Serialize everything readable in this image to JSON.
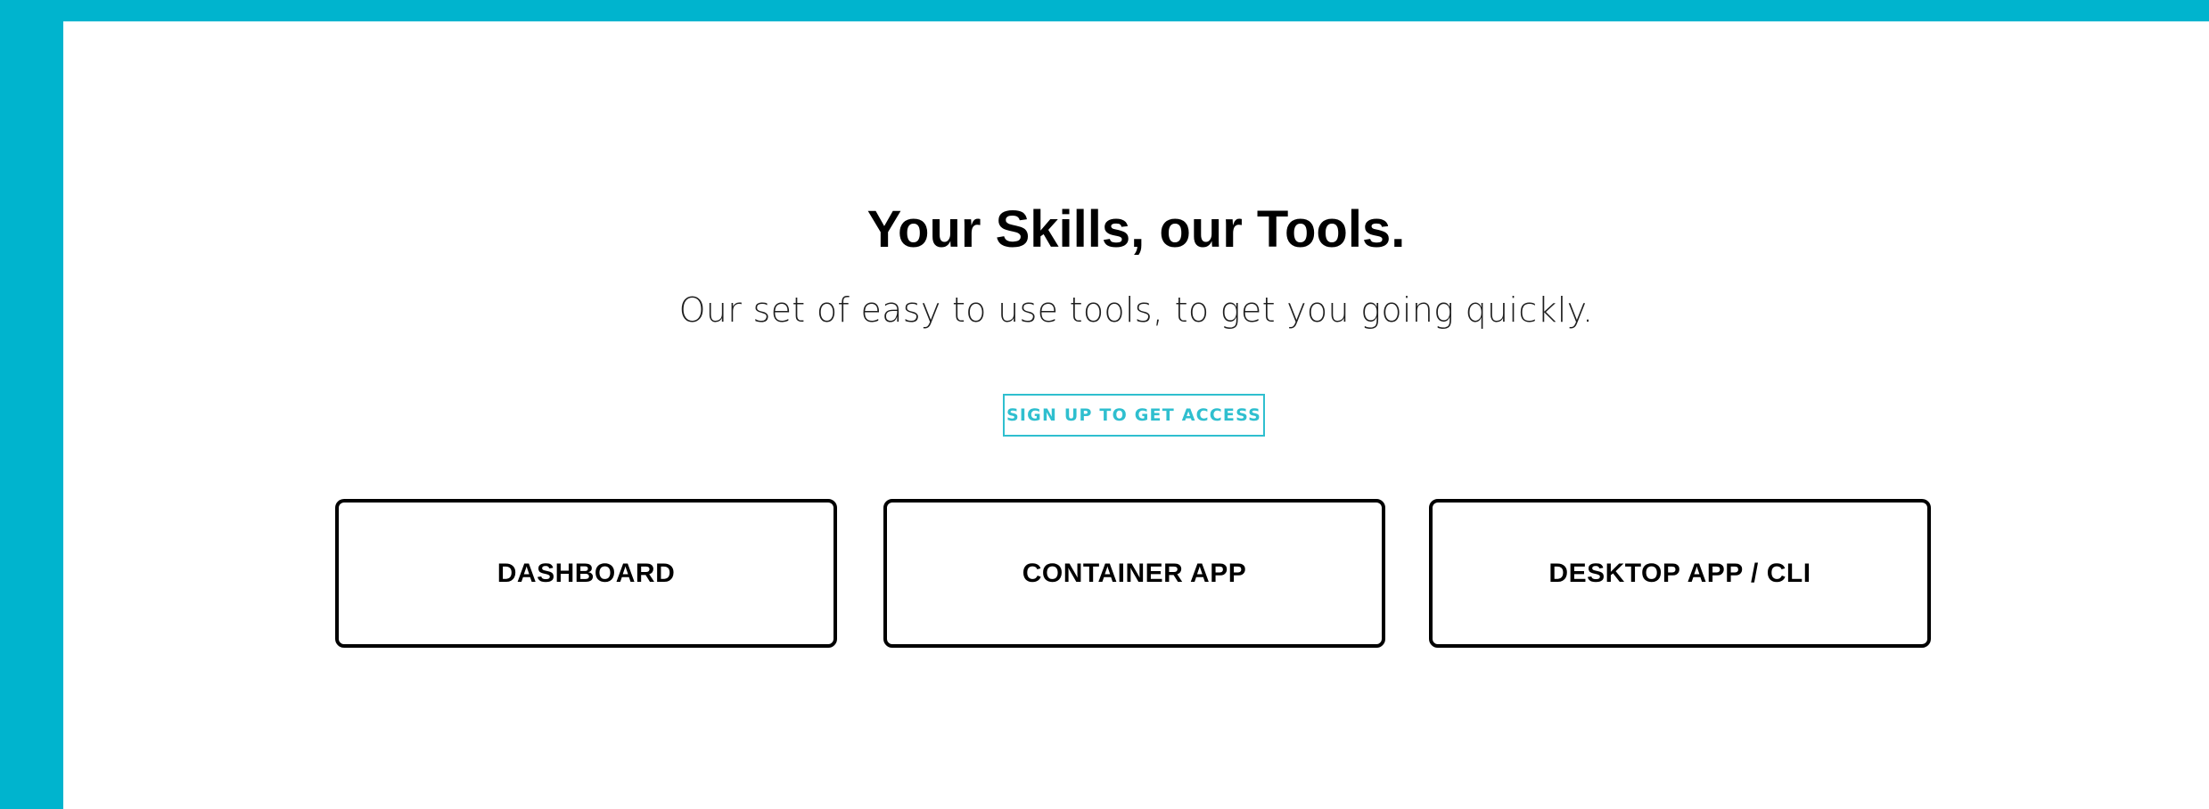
{
  "colors": {
    "frame_background": "#00b4ce",
    "panel_background": "#ffffff",
    "accent": "#2fbfcf",
    "text_primary": "#000000"
  },
  "hero": {
    "title": "Your Skills, our Tools.",
    "subtitle": "Our set of easy to use tools, to get you going quickly.",
    "cta_label": "SIGN UP TO GET ACCESS"
  },
  "tools": [
    {
      "label": "DASHBOARD"
    },
    {
      "label": "CONTAINER APP"
    },
    {
      "label": "DESKTOP APP / CLI"
    }
  ]
}
